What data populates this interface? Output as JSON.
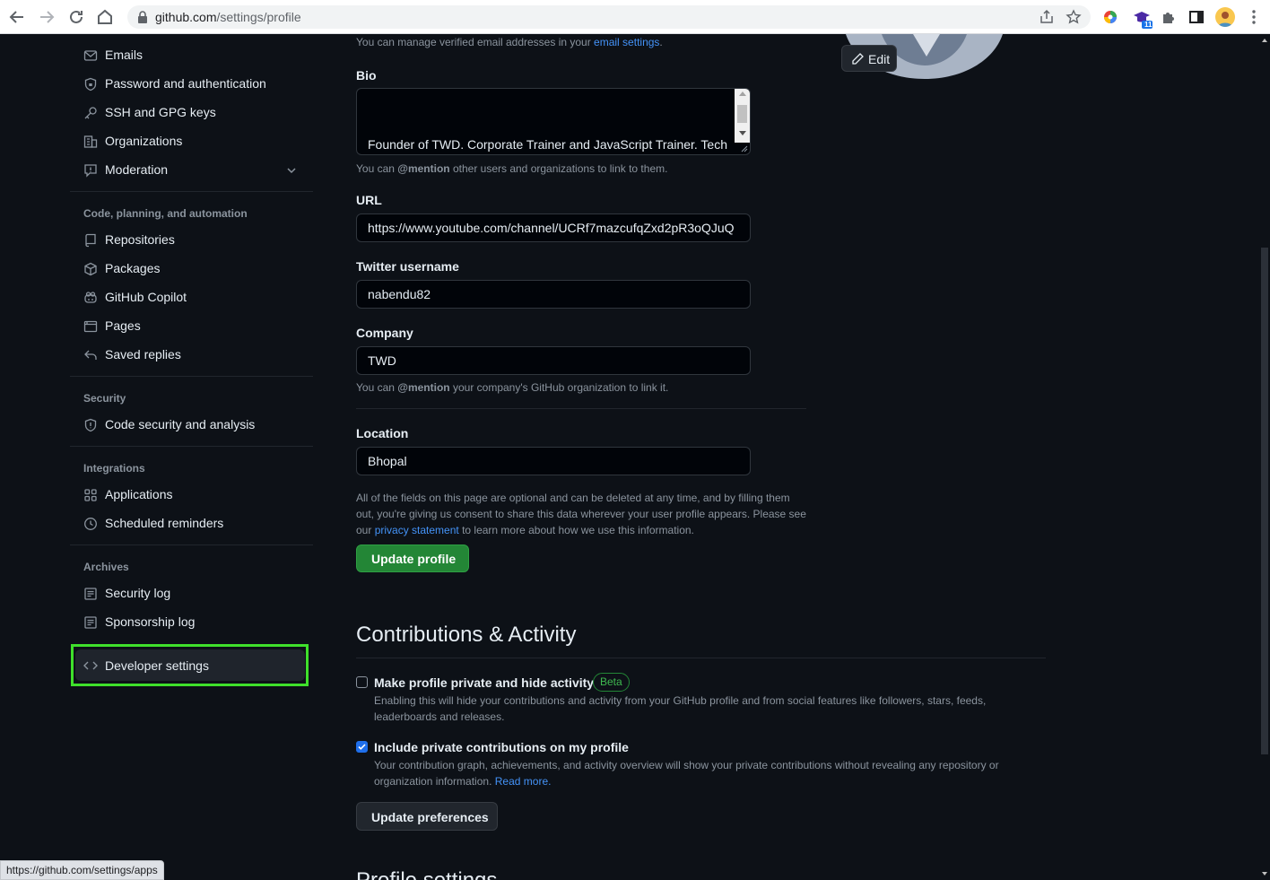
{
  "browser": {
    "url_host": "github.com",
    "url_path": "/settings/profile",
    "status_url": "https://github.com/settings/apps",
    "ext_badge": "11"
  },
  "sidebar": {
    "items_top": [
      {
        "label": "Emails",
        "icon": "mail-icon"
      },
      {
        "label": "Password and authentication",
        "icon": "shield-lock-icon"
      },
      {
        "label": "SSH and GPG keys",
        "icon": "key-icon"
      },
      {
        "label": "Organizations",
        "icon": "organization-icon"
      },
      {
        "label": "Moderation",
        "icon": "report-icon"
      }
    ],
    "section_code": "Code, planning, and automation",
    "items_code": [
      {
        "label": "Repositories",
        "icon": "repo-icon"
      },
      {
        "label": "Packages",
        "icon": "package-icon"
      },
      {
        "label": "GitHub Copilot",
        "icon": "copilot-icon"
      },
      {
        "label": "Pages",
        "icon": "browser-icon"
      },
      {
        "label": "Saved replies",
        "icon": "reply-icon"
      }
    ],
    "section_security": "Security",
    "items_security": [
      {
        "label": "Code security and analysis",
        "icon": "codescan-icon"
      }
    ],
    "section_integrations": "Integrations",
    "items_integrations": [
      {
        "label": "Applications",
        "icon": "apps-icon"
      },
      {
        "label": "Scheduled reminders",
        "icon": "clock-icon"
      }
    ],
    "section_archives": "Archives",
    "items_archives": [
      {
        "label": "Security log",
        "icon": "log-icon"
      },
      {
        "label": "Sponsorship log",
        "icon": "log-icon"
      }
    ],
    "developer_settings": "Developer settings"
  },
  "profile": {
    "email_note_prefix": "You can manage verified email addresses in your ",
    "email_note_link": "email settings",
    "email_note_suffix": ".",
    "bio_label": "Bio",
    "bio_value": "Founder of TWD. Corporate Trainer and JavaScript Trainer. Tech",
    "bio_note_prefix": "You can ",
    "bio_note_mention": "@mention",
    "bio_note_suffix": " other users and organizations to link to them.",
    "url_label": "URL",
    "url_value": "https://www.youtube.com/channel/UCRf7mazcufqZxd2pR3oQJuQ",
    "twitter_label": "Twitter username",
    "twitter_value": "nabendu82",
    "company_label": "Company",
    "company_value": "TWD",
    "company_note_prefix": "You can ",
    "company_note_mention": "@mention",
    "company_note_suffix": " your company's GitHub organization to link it.",
    "location_label": "Location",
    "location_value": "Bhopal",
    "consent_line1": "All of the fields on this page are optional and can be deleted at any time, and by filling them",
    "consent_line2": "out, you're giving us consent to share this data wherever your user profile appears. Please see",
    "consent_line3_prefix": "our ",
    "consent_link": "privacy statement",
    "consent_line3_suffix": " to learn more about how we use this information.",
    "update_button": "Update profile",
    "edit_button": "Edit"
  },
  "contributions": {
    "heading": "Contributions & Activity",
    "private_title": "Make profile private and hide activity",
    "private_badge": "Beta",
    "private_checked": false,
    "private_desc": "Enabling this will hide your contributions and activity from your GitHub profile and from social features like followers, stars, feeds, leaderboards and releases.",
    "include_title": "Include private contributions on my profile",
    "include_checked": true,
    "include_desc_prefix": "Your contribution graph, achievements, and activity overview will show your private contributions without revealing any repository or organization information. ",
    "include_link": "Read more.",
    "update_button": "Update preferences",
    "next_heading": "Profile settings"
  }
}
